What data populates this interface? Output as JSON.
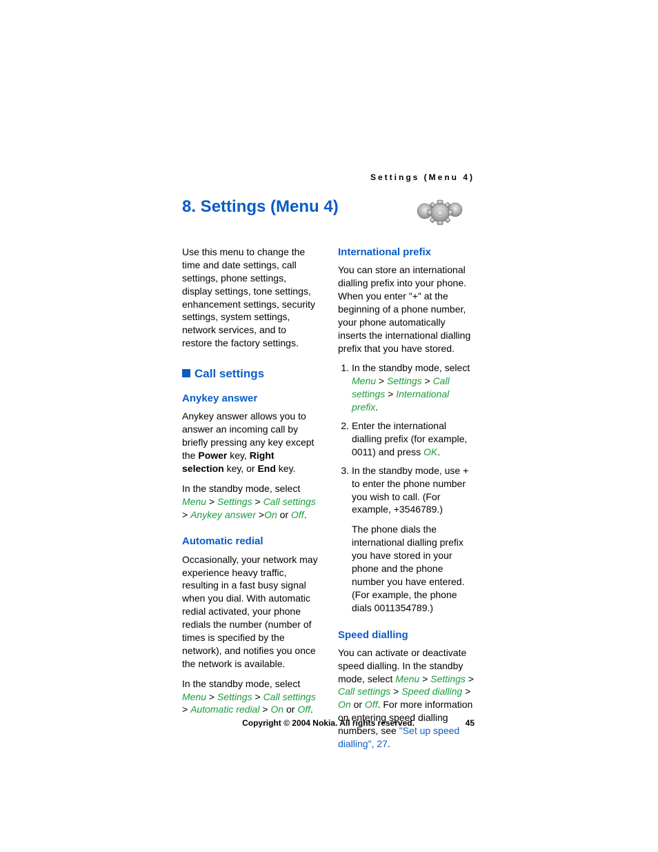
{
  "running_header": "Settings (Menu 4)",
  "title": "8. Settings (Menu 4)",
  "intro": "Use this menu to change the time and date settings, call settings, phone settings, display settings, tone settings, enhancement settings, security settings, system settings, network services, and to restore the factory settings.",
  "section_call_settings": "Call settings",
  "anykey": {
    "heading": "Anykey answer",
    "p1_a": "Anykey answer allows you to answer an incoming call by briefly pressing any key except the ",
    "p1_b": "Power",
    "p1_c": " key, ",
    "p1_d": "Right selection",
    "p1_e": " key, or ",
    "p1_f": "End",
    "p1_g": " key.",
    "p2_a": "In the standby mode, select ",
    "p2_path1": "Menu",
    "p2_path2": "Settings",
    "p2_path3": "Call settings",
    "p2_path4": "Anykey answer",
    "p2_path5": "On",
    "p2_or": " or ",
    "p2_path6": "Off",
    "p2_end": "."
  },
  "autoredial": {
    "heading": "Automatic redial",
    "p1": "Occasionally, your network may experience heavy traffic, resulting in a fast busy signal when you dial. With automatic redial activated, your phone redials the number (number of times is specified by the network), and notifies you once the network is available.",
    "p2_a": "In the standby mode, select ",
    "p2_path1": "Menu",
    "p2_path2": "Settings",
    "p2_path3": "Call settings",
    "p2_path4": "Automatic redial",
    "p2_path5": "On",
    "p2_or": " or ",
    "p2_path6": "Off",
    "p2_end": "."
  },
  "intlprefix": {
    "heading": "International prefix",
    "p1": "You can store an international dialling prefix into your phone. When you enter \"+\" at the beginning of a phone number, your phone automatically inserts the international dialling prefix that you have stored.",
    "li1_a": "In the standby mode, select ",
    "li1_path1": "Menu",
    "li1_path2": "Settings",
    "li1_path3": "Call settings",
    "li1_path4": "International prefix",
    "li1_end": ".",
    "li2_a": "Enter the international dialling prefix (for example, 0011) and press ",
    "li2_ok": "OK",
    "li2_end": ".",
    "li3": "In the standby mode, use + to enter the phone number you wish to call. (For example, +3546789.)",
    "li3_follow": "The phone dials the international dialling prefix you have stored in your phone and the phone number you have entered. (For example, the phone dials 0011354789.)"
  },
  "speed": {
    "heading": "Speed dialling",
    "p1_a": "You can activate or deactivate speed dialling. In the standby mode, select ",
    "p1_path1": "Menu",
    "p1_path2": "Settings",
    "p1_path3": "Call settings",
    "p1_path4": "Speed dialling",
    "p1_path5": "On",
    "p1_or": " or ",
    "p1_path6": "Off",
    "p1_b": ". For more information on entering speed dialling numbers, see ",
    "p1_xref": "\"Set up speed dialling\", 27",
    "p1_end": "."
  },
  "footer": {
    "copyright": "Copyright © 2004 Nokia. All rights reserved.",
    "page": "45"
  }
}
